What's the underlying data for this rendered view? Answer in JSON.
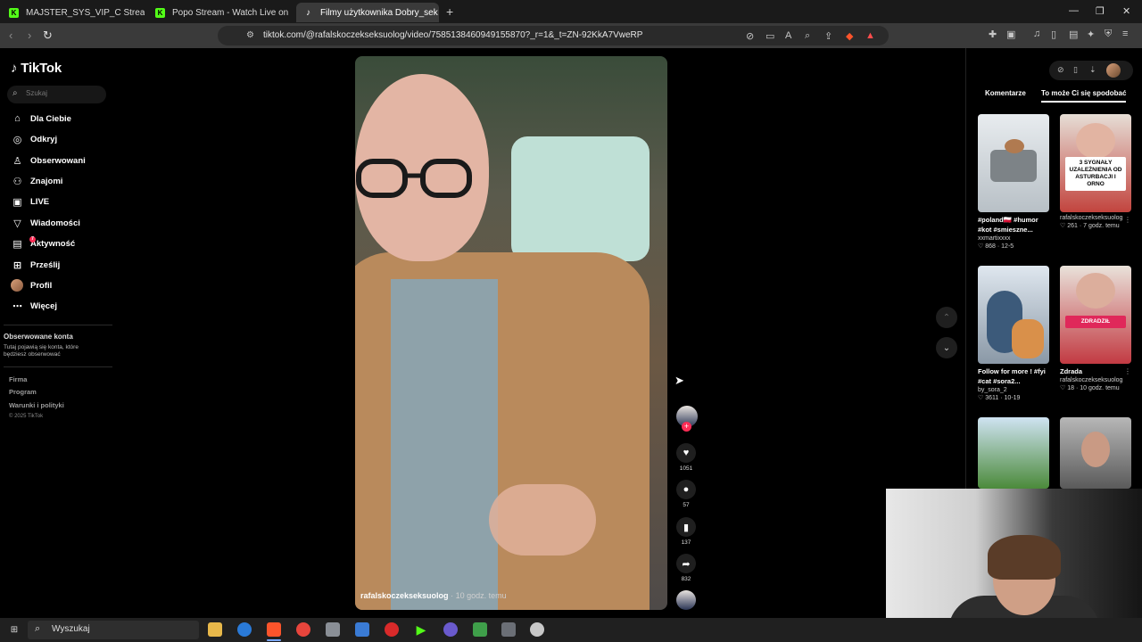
{
  "browser": {
    "tabs": [
      {
        "title": "MAJSTER_SYS_VIP_C Stream - Watch",
        "icon": "kick-icon"
      },
      {
        "title": "Popo Stream - Watch Live on Kick",
        "icon": "kick-icon"
      },
      {
        "title": "Filmy użytkownika Dobry_sek",
        "icon": "tiktok-icon",
        "active": true
      }
    ],
    "url": "tiktok.com/@rafalskoczekseksuolog/video/7585138460949155870?_r=1&_t=ZN-92KkA7VweRP"
  },
  "tiktok": {
    "logo": "TikTok",
    "search_placeholder": "Szukaj",
    "nav": [
      {
        "label": "Dla Ciebie",
        "icon": "home-icon"
      },
      {
        "label": "Odkryj",
        "icon": "compass-icon"
      },
      {
        "label": "Obserwowani",
        "icon": "user-icon"
      },
      {
        "label": "Znajomi",
        "icon": "users-icon"
      },
      {
        "label": "LIVE",
        "icon": "live-icon"
      },
      {
        "label": "Wiadomości",
        "icon": "send-icon"
      },
      {
        "label": "Aktywność",
        "icon": "activity-icon",
        "badge": "7"
      },
      {
        "label": "Prześlij",
        "icon": "upload-icon"
      },
      {
        "label": "Profil",
        "icon": "avatar-icon"
      },
      {
        "label": "Więcej",
        "icon": "more-icon"
      }
    ],
    "followed_heading": "Obserwowane konta",
    "followed_text": "Tutaj pojawią się konta, które będziesz obserwować",
    "footer": [
      "Firma",
      "Program",
      "Warunki i polityki"
    ],
    "copyright": "© 2025 TikTok"
  },
  "video": {
    "author": "rafalskoczekseksuolog",
    "time": "· 10 godz. temu",
    "likes": "1051",
    "comments": "57",
    "saves": "137",
    "shares": "832"
  },
  "right_panel": {
    "tabs": [
      "Komentarze",
      "To może Ci się spodobać"
    ],
    "active_tab": 1,
    "cards": [
      {
        "title": "#poland🇵🇱 #humor #kot #smieszne...",
        "author": "xxmartixxxx",
        "likes": "868",
        "date": "12-5",
        "thumb_text": ""
      },
      {
        "title": "",
        "author": "rafalskoczekseksuolog",
        "likes": "261",
        "date": "7 godz. temu",
        "thumb_text": "3 SYGNAŁY UZALEŻNIENIA OD ASTURBACJI I ORNO"
      },
      {
        "title": "Follow for more ! #fyi #cat #sora2...",
        "author": "by_sora_2",
        "likes": "3611",
        "date": "10-19",
        "thumb_text": ""
      },
      {
        "title": "Zdrada",
        "author": "rafalskoczekseksuolog",
        "likes": "18",
        "date": "10 godz. temu",
        "thumb_text": "ZDRADZIŁ"
      }
    ]
  },
  "taskbar": {
    "search_label": "Wyszukaj"
  },
  "colors": {
    "accent": "#fe2c55",
    "kick_green": "#53fc18",
    "page_bg": "#000000",
    "chrome_bg": "#3a3a3a"
  }
}
